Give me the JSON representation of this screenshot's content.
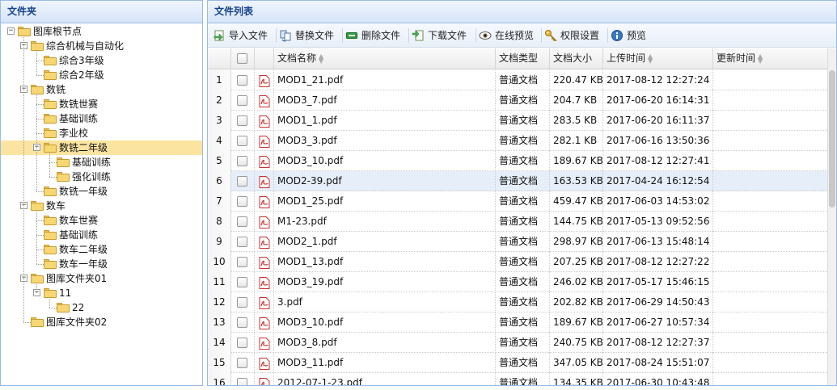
{
  "folder_panel": {
    "title": "文件夹",
    "tree": [
      {
        "label": "图库根节点",
        "level": 0,
        "toggle": "-"
      },
      {
        "label": "综合机械与自动化",
        "level": 1,
        "toggle": "-"
      },
      {
        "label": "综合3年级",
        "level": 2,
        "toggle": ""
      },
      {
        "label": "综合2年级",
        "level": 2,
        "toggle": ""
      },
      {
        "label": "数铣",
        "level": 1,
        "toggle": "-"
      },
      {
        "label": "数铣世赛",
        "level": 2,
        "toggle": ""
      },
      {
        "label": "基础训练",
        "level": 2,
        "toggle": ""
      },
      {
        "label": "李业校",
        "level": 2,
        "toggle": ""
      },
      {
        "label": "数铣二年级",
        "level": 2,
        "toggle": "-",
        "selected": true
      },
      {
        "label": "基础训练",
        "level": 3,
        "toggle": ""
      },
      {
        "label": "强化训练",
        "level": 3,
        "toggle": ""
      },
      {
        "label": "数铣一年级",
        "level": 2,
        "toggle": ""
      },
      {
        "label": "数车",
        "level": 1,
        "toggle": "-"
      },
      {
        "label": "数车世赛",
        "level": 2,
        "toggle": ""
      },
      {
        "label": "基础训练",
        "level": 2,
        "toggle": ""
      },
      {
        "label": "数车二年级",
        "level": 2,
        "toggle": ""
      },
      {
        "label": "数车一年级",
        "level": 2,
        "toggle": ""
      },
      {
        "label": "图库文件夹01",
        "level": 1,
        "toggle": "-"
      },
      {
        "label": "11",
        "level": 2,
        "toggle": "-"
      },
      {
        "label": "22",
        "level": 3,
        "toggle": ""
      },
      {
        "label": "图库文件夹02",
        "level": 1,
        "toggle": ""
      }
    ]
  },
  "file_panel": {
    "title": "文件列表",
    "toolbar": [
      {
        "label": "导入文件",
        "icon": "import-icon"
      },
      {
        "label": "替换文件",
        "icon": "replace-icon"
      },
      {
        "label": "删除文件",
        "icon": "delete-icon"
      },
      {
        "label": "下载文件",
        "icon": "download-icon"
      },
      {
        "label": "在线预览",
        "icon": "eye-icon"
      },
      {
        "label": "权限设置",
        "icon": "key-icon"
      },
      {
        "label": "预览",
        "icon": "info-icon"
      }
    ],
    "columns": [
      "文档名称",
      "文档类型",
      "文档大小",
      "上传时间",
      "更新时间"
    ],
    "rows": [
      {
        "num": "1",
        "name": "MOD1_21.pdf",
        "type": "普通文档",
        "size": "220.47 KB",
        "upload": "2017-08-12 12:27:24",
        "update": ""
      },
      {
        "num": "2",
        "name": "MOD3_7.pdf",
        "type": "普通文档",
        "size": "204.7 KB",
        "upload": "2017-06-20 16:14:31",
        "update": ""
      },
      {
        "num": "3",
        "name": "MOD1_1.pdf",
        "type": "普通文档",
        "size": "283.5 KB",
        "upload": "2017-06-20 16:11:37",
        "update": ""
      },
      {
        "num": "4",
        "name": "MOD3_3.pdf",
        "type": "普通文档",
        "size": "282.1 KB",
        "upload": "2017-06-16 13:50:36",
        "update": ""
      },
      {
        "num": "5",
        "name": "MOD3_10.pdf",
        "type": "普通文档",
        "size": "189.67 KB",
        "upload": "2017-08-12 12:27:41",
        "update": ""
      },
      {
        "num": "6",
        "name": "MOD2-39.pdf",
        "type": "普通文档",
        "size": "163.53 KB",
        "upload": "2017-04-24 16:12:54",
        "update": ""
      },
      {
        "num": "7",
        "name": "MOD1_25.pdf",
        "type": "普通文档",
        "size": "459.47 KB",
        "upload": "2017-06-03 14:53:02",
        "update": ""
      },
      {
        "num": "8",
        "name": "M1-23.pdf",
        "type": "普通文档",
        "size": "144.75 KB",
        "upload": "2017-05-13 09:52:56",
        "update": ""
      },
      {
        "num": "9",
        "name": "MOD2_1.pdf",
        "type": "普通文档",
        "size": "298.97 KB",
        "upload": "2017-06-13 15:48:14",
        "update": ""
      },
      {
        "num": "10",
        "name": "MOD1_13.pdf",
        "type": "普通文档",
        "size": "207.25 KB",
        "upload": "2017-08-12 12:27:22",
        "update": ""
      },
      {
        "num": "11",
        "name": "MOD3_19.pdf",
        "type": "普通文档",
        "size": "246.02 KB",
        "upload": "2017-05-17 15:46:15",
        "update": ""
      },
      {
        "num": "12",
        "name": "3.pdf",
        "type": "普通文档",
        "size": "202.82 KB",
        "upload": "2017-06-29 14:50:43",
        "update": ""
      },
      {
        "num": "13",
        "name": "MOD3_10.pdf",
        "type": "普通文档",
        "size": "189.67 KB",
        "upload": "2017-06-27 10:57:34",
        "update": ""
      },
      {
        "num": "14",
        "name": "MOD3_8.pdf",
        "type": "普通文档",
        "size": "240.75 KB",
        "upload": "2017-08-12 12:27:37",
        "update": ""
      },
      {
        "num": "15",
        "name": "MOD3_11.pdf",
        "type": "普通文档",
        "size": "347.05 KB",
        "upload": "2017-08-24 15:51:07",
        "update": ""
      },
      {
        "num": "16",
        "name": "2012-07-1-23.pdf",
        "type": "普通文档",
        "size": "134.35 KB",
        "upload": "2017-06-30 10:43:48",
        "update": ""
      }
    ],
    "highlighted_row": 6
  }
}
